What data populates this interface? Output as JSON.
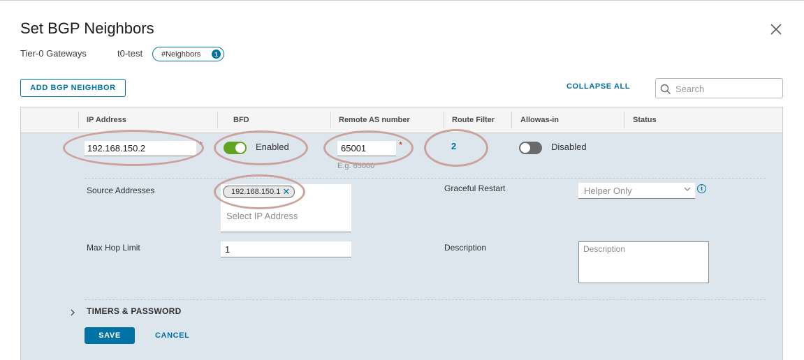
{
  "dialog": {
    "title": "Set BGP Neighbors",
    "breadcrumb": {
      "gateway_type": "Tier-0 Gateways",
      "gateway_name": "t0-test",
      "pill_label": "#Neighbors",
      "pill_count": "1"
    }
  },
  "toolbar": {
    "add_label": "ADD BGP NEIGHBOR",
    "collapse_label": "COLLAPSE ALL",
    "search_placeholder": "Search"
  },
  "table": {
    "columns": [
      "IP Address",
      "BFD",
      "Remote AS number",
      "Route Filter",
      "Allowas-in",
      "Status"
    ]
  },
  "row": {
    "ip_address": "192.168.150.2",
    "bfd": {
      "state": "on",
      "label": "Enabled"
    },
    "remote_as": "65001",
    "remote_as_hint": "E.g. 65000",
    "route_filter": "2",
    "allowas_in": {
      "state": "off",
      "label": "Disabled"
    }
  },
  "details": {
    "source_addresses_label": "Source Addresses",
    "source_addresses": [
      "192.168.150.1"
    ],
    "source_placeholder": "Select IP Address",
    "graceful_restart_label": "Graceful Restart",
    "graceful_restart_value": "Helper Only",
    "max_hop_label": "Max Hop Limit",
    "max_hop_value": "1",
    "description_label": "Description",
    "description_placeholder": "Description",
    "timers_label": "TIMERS & PASSWORD"
  },
  "actions": {
    "save_label": "SAVE",
    "cancel_label": "CANCEL"
  },
  "colors": {
    "accent": "#0072a3",
    "toggle_on": "#62a420",
    "annotation": "#c99a95"
  }
}
